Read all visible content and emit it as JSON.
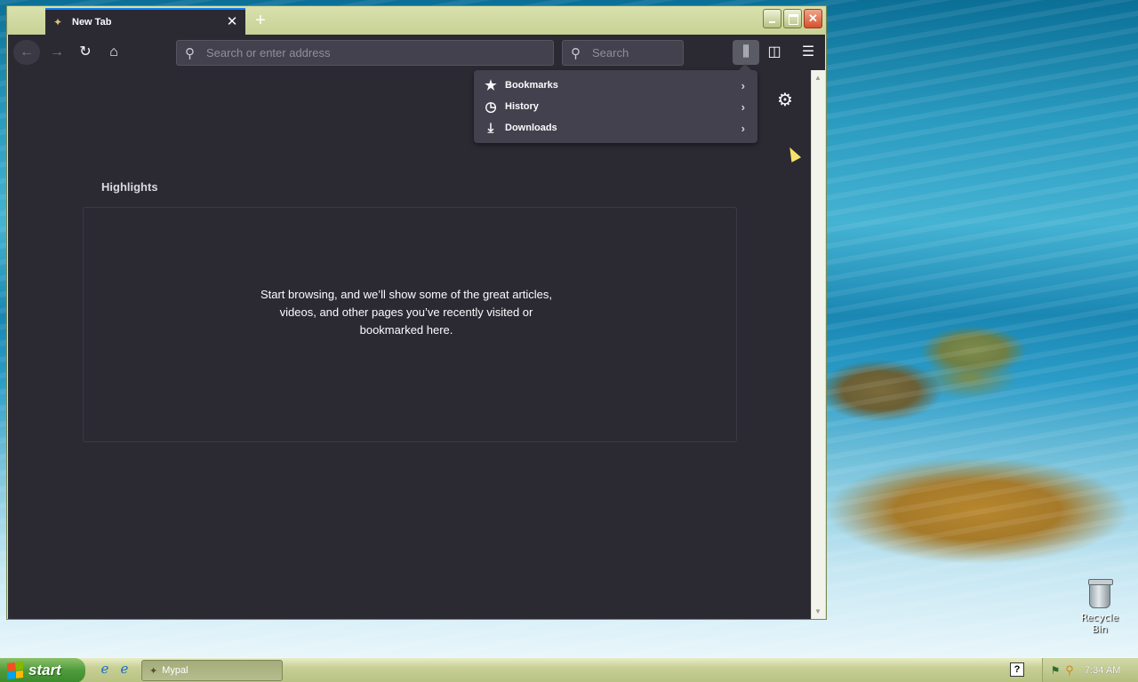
{
  "browser": {
    "tab_title": "New Tab",
    "tab_favicon": "mypal-icon",
    "close_tab_symbol": "✕",
    "new_tab_symbol": "+",
    "url_placeholder": "Search or enter address",
    "search_placeholder": "Search",
    "icons": {
      "back": "←",
      "forward": "→",
      "reload": "↻",
      "home": "⌂",
      "search": "⚲",
      "library": "⫼",
      "sidebar": "◫",
      "menu": "☰",
      "settings": "⚙"
    }
  },
  "library_menu": {
    "items": [
      {
        "label": "Bookmarks",
        "icon": "★",
        "arrow": "›"
      },
      {
        "label": "History",
        "icon": "◷",
        "arrow": "›"
      },
      {
        "label": "Downloads",
        "icon": "⤓",
        "arrow": "›"
      }
    ]
  },
  "newtab": {
    "highlights_title": "Highlights",
    "empty_message": "Start browsing, and we’ll show some of the great articles, videos, and other pages you’ve recently visited or bookmarked here."
  },
  "desktop": {
    "recycle_bin_label": "Recycle Bin"
  },
  "taskbar": {
    "start_label": "start",
    "task_label": "Mypal",
    "help_symbol": "?",
    "clock": "7:34 AM"
  },
  "colors": {
    "browser_dark": "#2b2a33",
    "menu_bg": "#42414d",
    "tab_accent": "#0a84ff",
    "xp_olive": "#c5cd9a"
  }
}
